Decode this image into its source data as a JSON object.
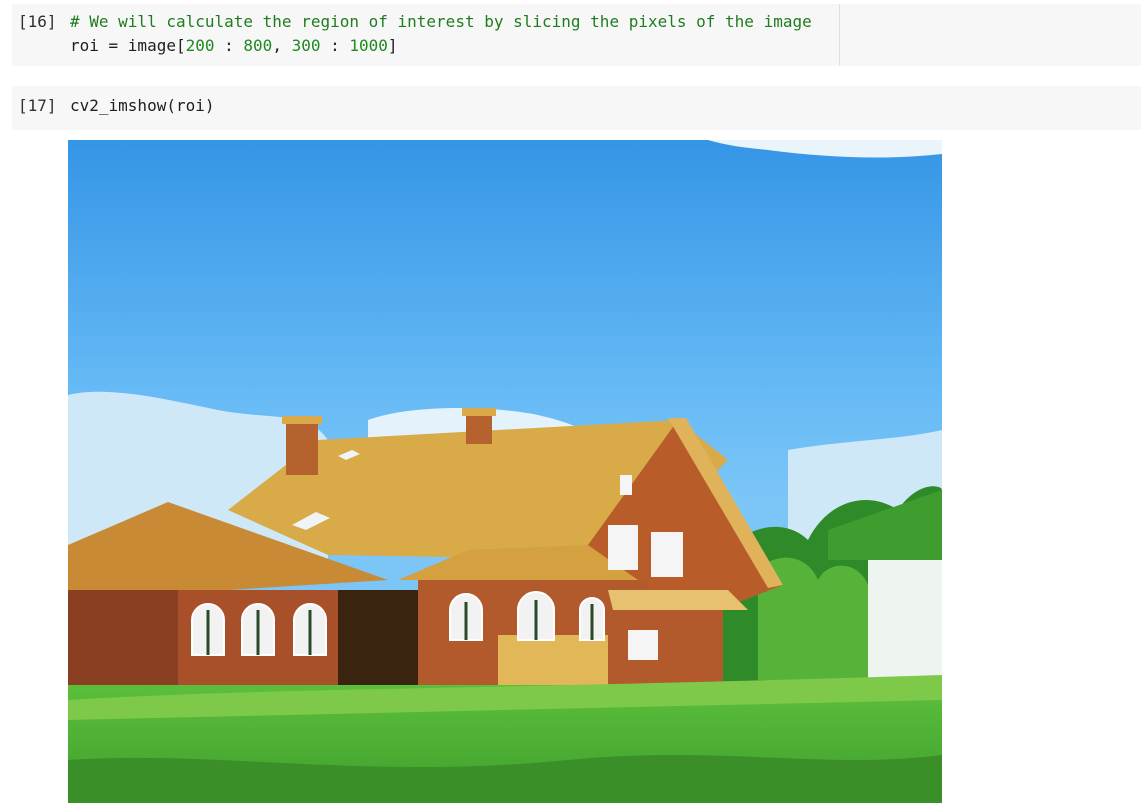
{
  "cells": [
    {
      "prompt": "[16]",
      "lines": [
        {
          "comment": "# We will calculate the region of interest by slicing the pixels of the image"
        },
        {
          "prefix": "roi = image[",
          "n1": "200",
          "s1": " : ",
          "n2": "800",
          "s2": ", ",
          "n3": "300",
          "s3": " : ",
          "n4": "1000",
          "suffix": "]"
        }
      ]
    },
    {
      "prompt": "[17]",
      "lines": [
        {
          "text": "cv2_imshow(roi)"
        }
      ]
    }
  ],
  "output": {
    "colors": {
      "sky_top": "#3a9be8",
      "sky_mid": "#64b8f3",
      "roof": "#d9a94a",
      "wall": "#b25a2c",
      "grass": "#4fb73a",
      "trees": "#2f8a2a"
    }
  }
}
